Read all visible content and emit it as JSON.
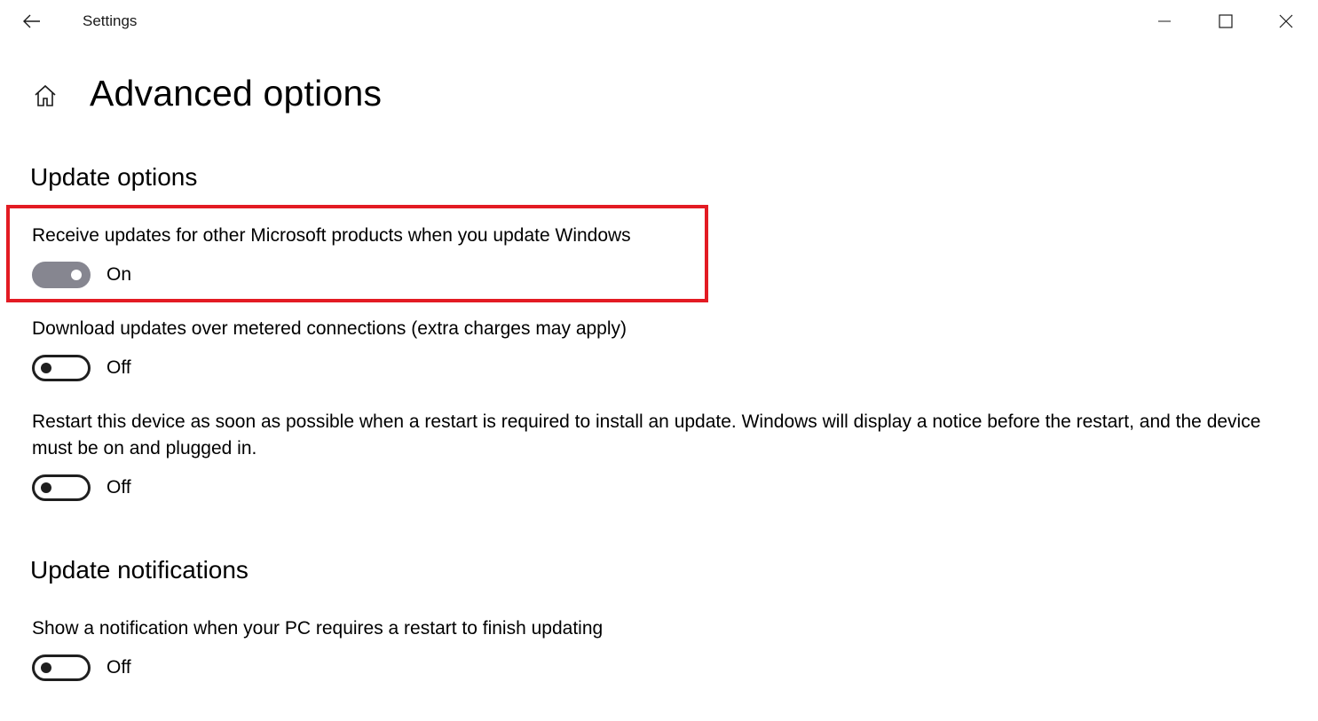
{
  "window": {
    "title": "Settings",
    "back_icon": "arrow-left-icon",
    "controls": [
      "minimize-icon",
      "maximize-icon",
      "close-icon"
    ]
  },
  "page": {
    "title": "Advanced options",
    "home_icon": "home-icon"
  },
  "sections": [
    {
      "title": "Update options",
      "settings": [
        {
          "label": "Receive updates for other Microsoft products when you update Windows",
          "state": "On",
          "enabled": true,
          "highlighted": true
        },
        {
          "label": "Download updates over metered connections (extra charges may apply)",
          "state": "Off",
          "enabled": false
        },
        {
          "label": "Restart this device as soon as possible when a restart is required to install an update. Windows will display a notice before the restart, and the device must be on and plugged in.",
          "state": "Off",
          "enabled": false
        }
      ]
    },
    {
      "title": "Update notifications",
      "settings": [
        {
          "label": "Show a notification when your PC requires a restart to finish updating",
          "state": "Off",
          "enabled": false
        }
      ]
    }
  ],
  "colors": {
    "highlight": "#e31b23",
    "toggle_on": "#868690",
    "toggle_off_border": "#1f1f1f"
  }
}
